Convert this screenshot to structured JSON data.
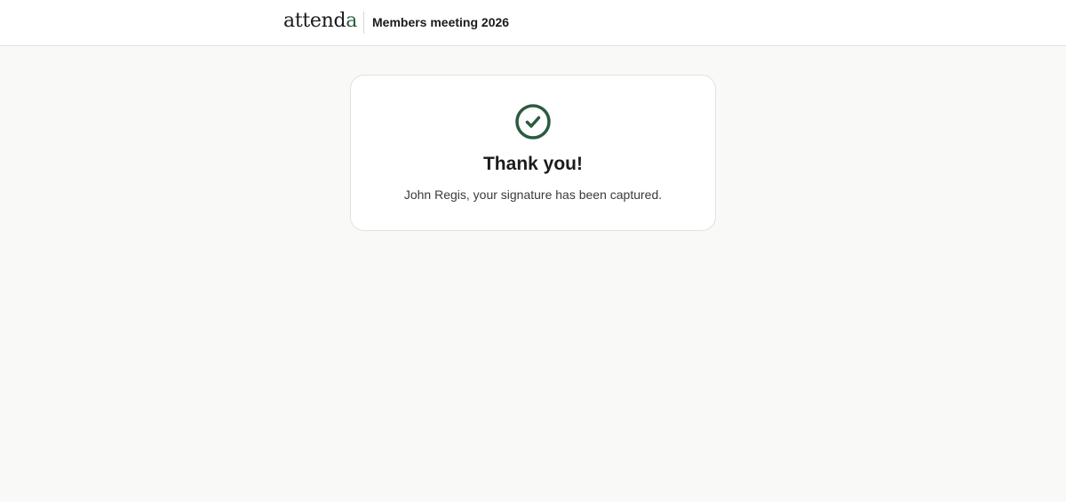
{
  "header": {
    "logo_text_main": "attend",
    "logo_text_accent": "a",
    "event_title": "Members meeting 2026"
  },
  "confirmation": {
    "icon": "check-circle-icon",
    "heading": "Thank you!",
    "message": "John Regis, your signature has been captured."
  },
  "colors": {
    "accent": "#2c5b3f",
    "background": "#f9f9f7",
    "card": "#ffffff"
  }
}
